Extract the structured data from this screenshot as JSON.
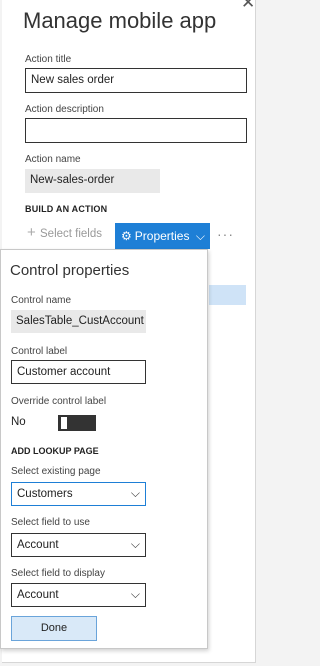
{
  "page": {
    "title": "Manage mobile app"
  },
  "form": {
    "action_title_label": "Action title",
    "action_title_value": "New sales order",
    "action_description_label": "Action description",
    "action_description_value": "",
    "action_name_label": "Action name",
    "action_name_value": "New-sales-order",
    "build_header": "BUILD AN ACTION"
  },
  "toolbar": {
    "select_fields_label": "Select fields",
    "properties_label": "Properties",
    "more_label": "···"
  },
  "control_properties": {
    "title": "Control properties",
    "control_name_label": "Control name",
    "control_name_value": "SalesTable_CustAccount",
    "control_label_label": "Control label",
    "control_label_value": "Customer account",
    "override_label": "Override control label",
    "override_state": "No",
    "lookup_header": "ADD LOOKUP PAGE",
    "existing_page_label": "Select existing page",
    "existing_page_value": "Customers",
    "field_to_use_label": "Select field to use",
    "field_to_use_value": "Account",
    "field_to_display_label": "Select field to display",
    "field_to_display_value": "Account",
    "done_label": "Done"
  },
  "icons": {
    "close": "close-icon",
    "plus": "plus-icon",
    "gear": "gear-icon",
    "chevron": "chevron-down-icon"
  },
  "colors": {
    "accent": "#1e7fd6",
    "highlight": "#cfe3f7",
    "readonly_bg": "#e9e9e9"
  }
}
